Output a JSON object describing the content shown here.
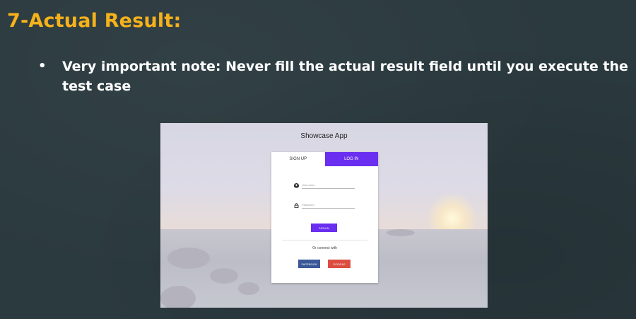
{
  "slide": {
    "title": "7-Actual Result:",
    "bullet_marker": "•",
    "bullet_text": "Very important note: Never fill the actual result field until you execute the test case"
  },
  "app": {
    "title": "Showcase App",
    "tabs": [
      {
        "label": "SIGN UP",
        "active": false
      },
      {
        "label": "LOG IN",
        "active": true
      }
    ],
    "username": {
      "placeholder": "Username",
      "value": "",
      "icon": "user-icon"
    },
    "password": {
      "placeholder": "Password",
      "value": "",
      "icon": "lock-icon"
    },
    "signin_label": "SIGN IN",
    "or_text": "Or connect with",
    "social": {
      "facebook": "FACEBOOK",
      "google": "GOOGLE"
    }
  },
  "colors": {
    "title": "#f6b21b",
    "accent": "#6a2ef0",
    "facebook": "#3b5998",
    "google": "#dc4e41"
  }
}
